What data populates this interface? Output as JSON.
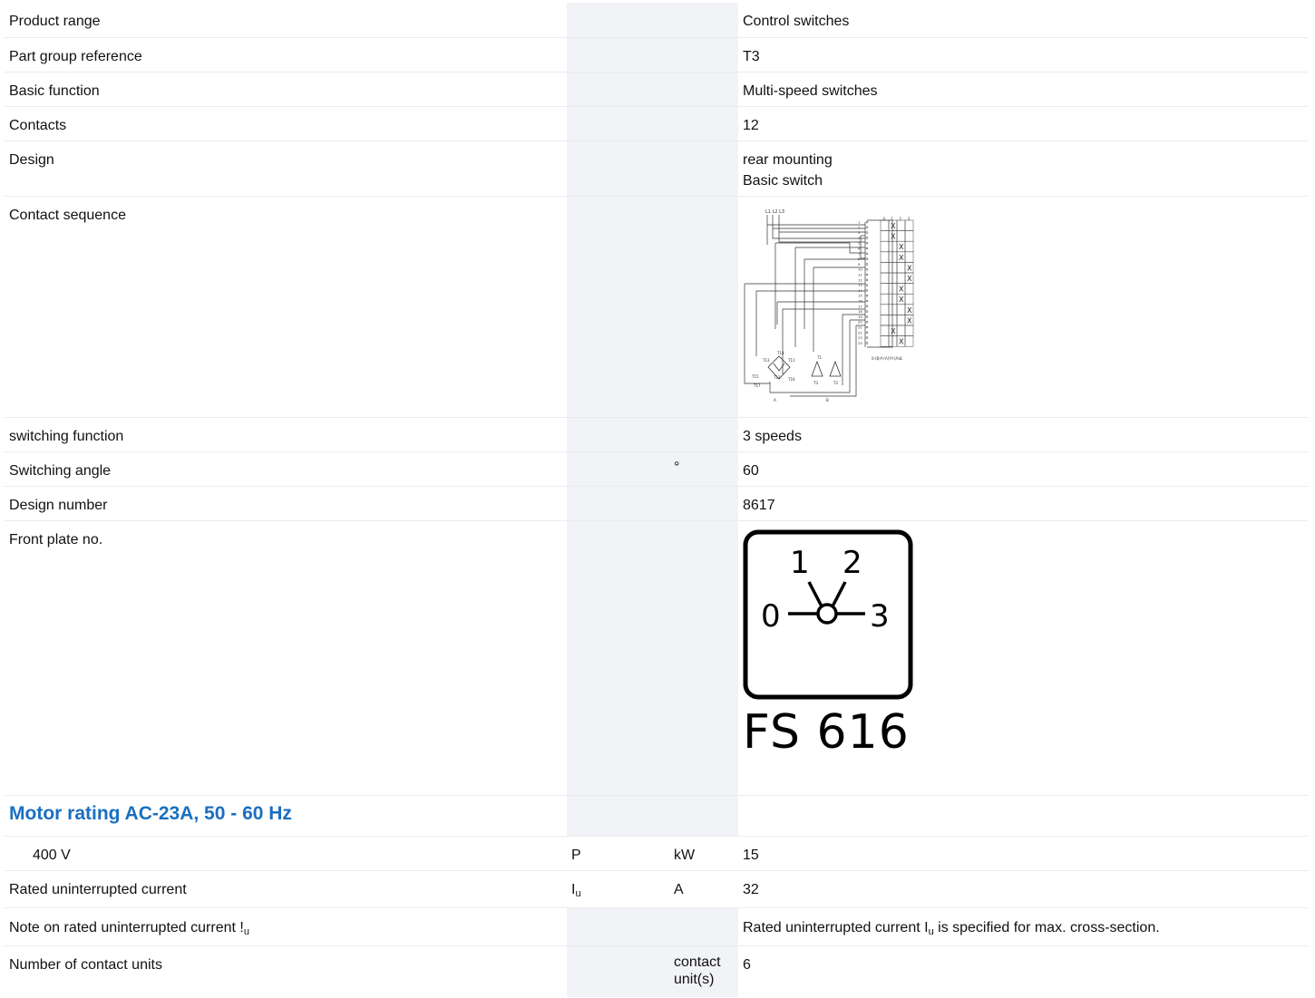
{
  "rows": [
    {
      "label": "Product range",
      "value": "Control switches"
    },
    {
      "label": "Part group reference",
      "value": "T3"
    },
    {
      "label": "Basic function",
      "value": "Multi-speed switches"
    },
    {
      "label": "Contacts",
      "value": "12"
    },
    {
      "label": "Design",
      "value_line1": "rear mounting",
      "value_line2": "Basic switch"
    },
    {
      "label": "Contact sequence"
    },
    {
      "label": "switching function",
      "value": "3 speeds"
    },
    {
      "label": "Switching angle",
      "unit": "°",
      "value": "60"
    },
    {
      "label": "Design number",
      "value": "8617"
    },
    {
      "label": "Front plate no.",
      "plate_text": "FS 616"
    }
  ],
  "section_title": "Motor rating AC-23A, 50 - 60 Hz",
  "motor_row": {
    "label": "400 V",
    "symbol": "P",
    "unit": "kW",
    "value": "15"
  },
  "current_row": {
    "label": "Rated uninterrupted current",
    "symbol_main": "I",
    "symbol_sub": "u",
    "unit": "A",
    "value": "32"
  },
  "note_row": {
    "label_main": "Note on rated uninterrupted current !",
    "label_sub": "u",
    "value_pre": "Rated uninterrupted current I",
    "value_sub": "u",
    "value_post": " is specified for max. cross-section."
  },
  "units_row": {
    "label": "Number of contact units",
    "unit": "contact unit(s)",
    "value": "6"
  },
  "diagram": {
    "supply_labels": "L1 L2 L3",
    "switch_positions": [
      "0",
      "1",
      "2",
      "3"
    ],
    "terminals": [
      "1",
      "2",
      "3",
      "4",
      "5",
      "6",
      "7",
      "8",
      "9",
      "10",
      "11",
      "12",
      "13",
      "14",
      "15",
      "16",
      "17",
      "18",
      "19",
      "20",
      "21",
      "22",
      "23",
      "24"
    ],
    "motor_a": "A",
    "motor_b": "B",
    "winding_labels": [
      "T14",
      "T13",
      "T11",
      "T15",
      "T12",
      "T16",
      "T17",
      "T1",
      "T3",
      "T2"
    ],
    "caption": "0-(B)Y-(A)YY-(A)Δ"
  },
  "front_plate": {
    "positions": [
      "0",
      "1",
      "2",
      "3"
    ]
  }
}
